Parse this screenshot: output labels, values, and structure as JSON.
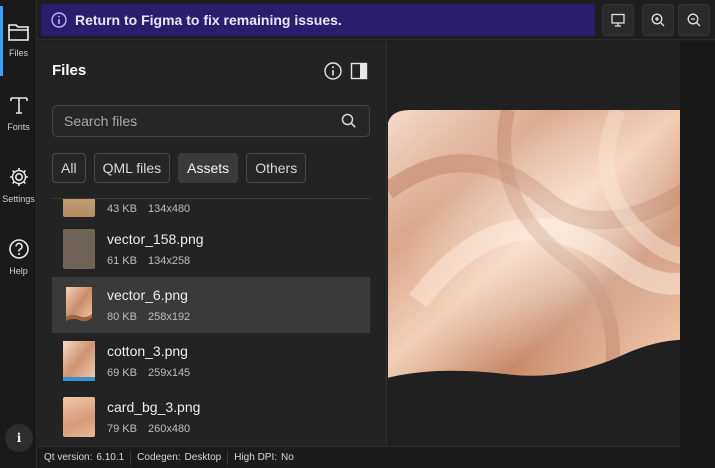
{
  "rail": {
    "items": [
      {
        "label": "Files",
        "icon": "folder-icon"
      },
      {
        "label": "Fonts",
        "icon": "font-icon"
      },
      {
        "label": "Settings",
        "icon": "gear-icon"
      },
      {
        "label": "Help",
        "icon": "help-icon"
      }
    ],
    "info_label": "i"
  },
  "banner": {
    "text": "Return to Figma to fix remaining issues."
  },
  "panel": {
    "title": "Files",
    "search_placeholder": "Search files",
    "tabs": [
      {
        "label": "All"
      },
      {
        "label": "QML files"
      },
      {
        "label": "Assets",
        "active": true
      },
      {
        "label": "Others"
      }
    ],
    "files": [
      {
        "name": "",
        "size": "43 KB",
        "dims": "134x480"
      },
      {
        "name": "vector_158.png",
        "size": "61 KB",
        "dims": "134x258"
      },
      {
        "name": "vector_6.png",
        "size": "80 KB",
        "dims": "258x192",
        "selected": true
      },
      {
        "name": "cotton_3.png",
        "size": "69 KB",
        "dims": "259x145"
      },
      {
        "name": "card_bg_3.png",
        "size": "79 KB",
        "dims": "260x480"
      }
    ]
  },
  "status": {
    "qt_label": "Qt version:",
    "qt_value": "6.10.1",
    "codegen_label": "Codegen:",
    "codegen_value": "Desktop",
    "dpi_label": "High DPI:",
    "dpi_value": "No"
  },
  "colors": {
    "accent": "#3aa0ff",
    "banner_bg": "#2a1e6c",
    "selected_row": "#3a3a3a",
    "silk": "#e6b89c",
    "bronze": "#a0643a"
  }
}
